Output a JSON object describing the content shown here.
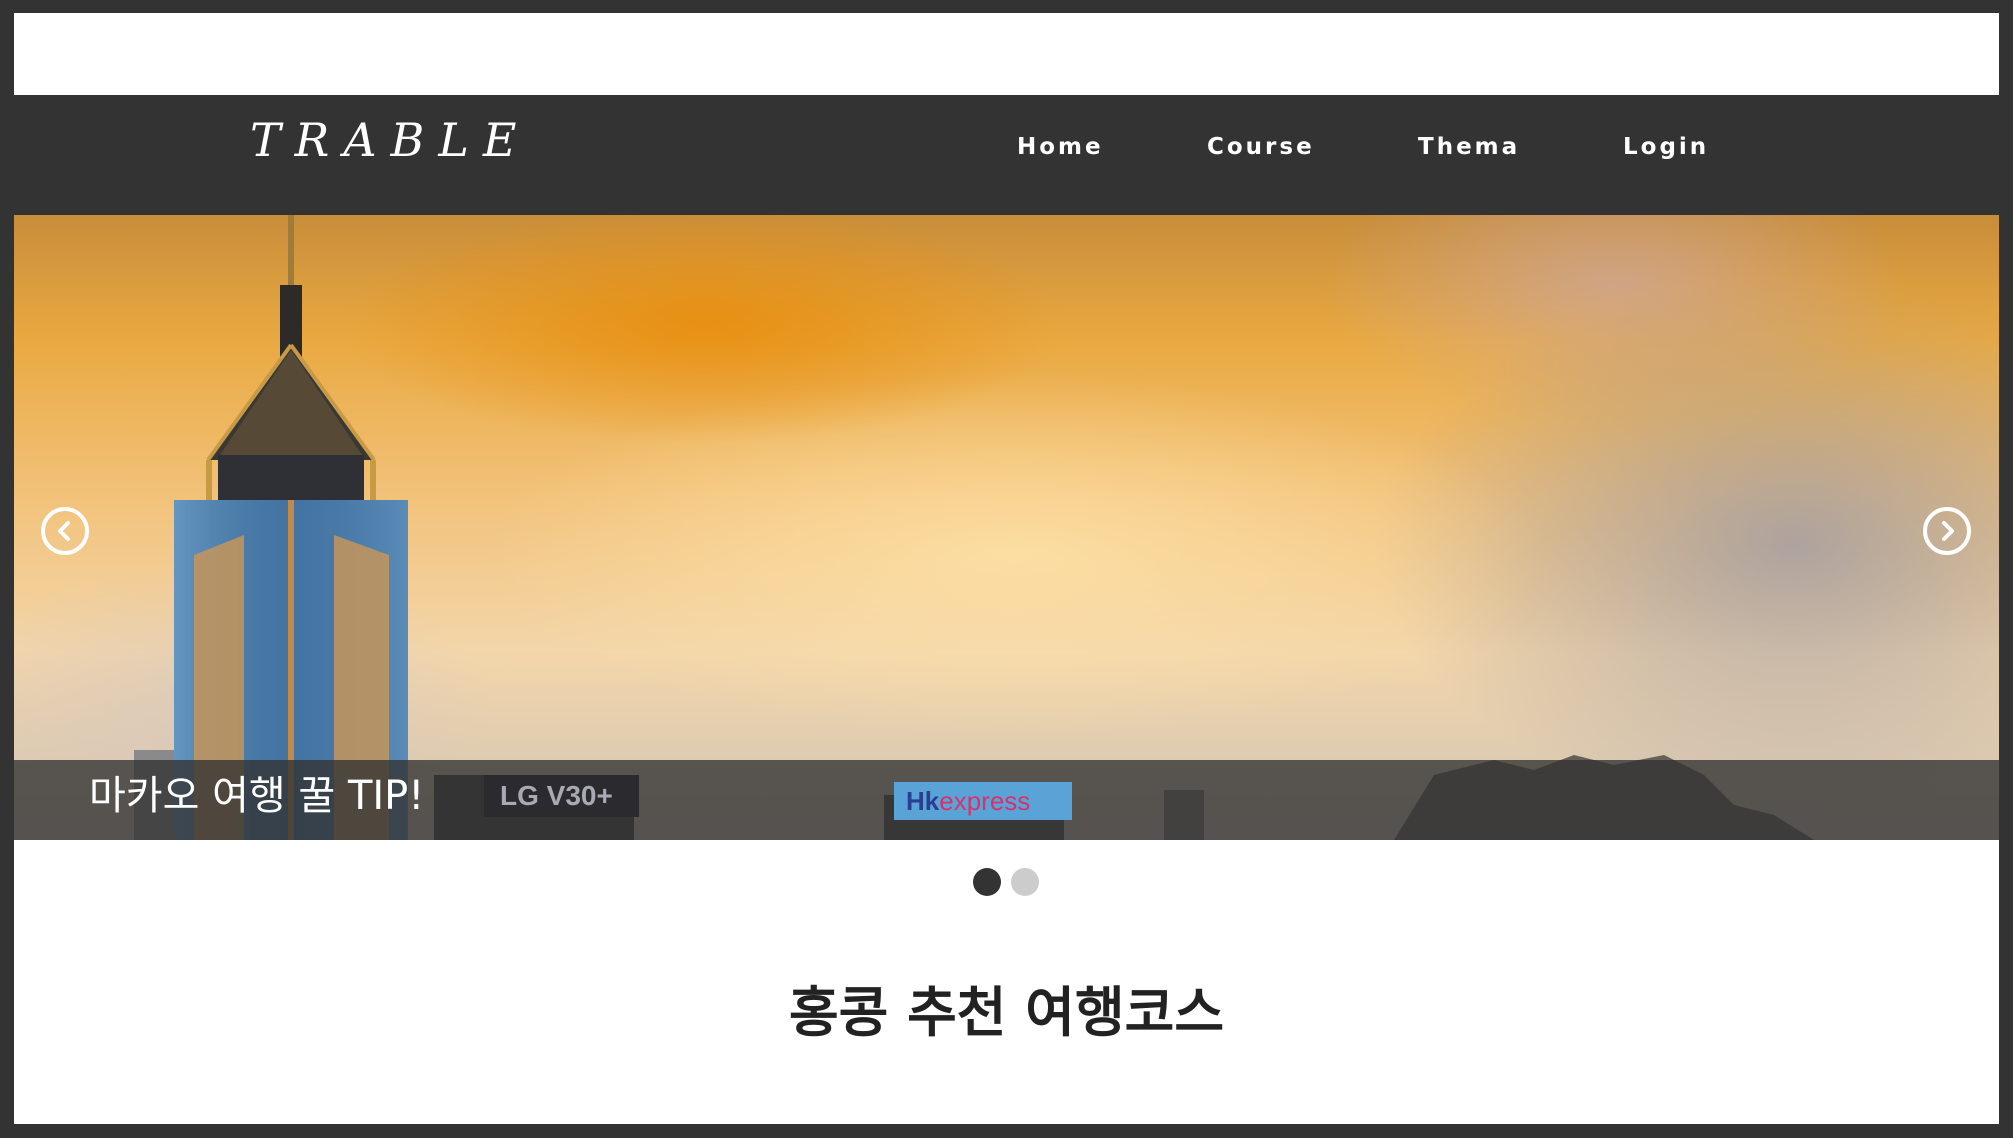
{
  "header": {
    "logo": "TRABLE",
    "nav": [
      {
        "label": "Home"
      },
      {
        "label": "Course"
      },
      {
        "label": "Thema"
      },
      {
        "label": "Login"
      }
    ]
  },
  "hero": {
    "caption": "마카오 여행 꿀 TIP!",
    "billboards": {
      "lg": "LG V30+",
      "hk_prefix": "Hk",
      "hk_express": "express"
    },
    "slides_total": 2,
    "active_slide": 1
  },
  "section": {
    "title": "홍콩 추천 여행코스"
  },
  "colors": {
    "nav_bg": "#333333",
    "page_bg": "#ffffff",
    "dot_active": "#333333",
    "dot_inactive": "#cccccc"
  }
}
